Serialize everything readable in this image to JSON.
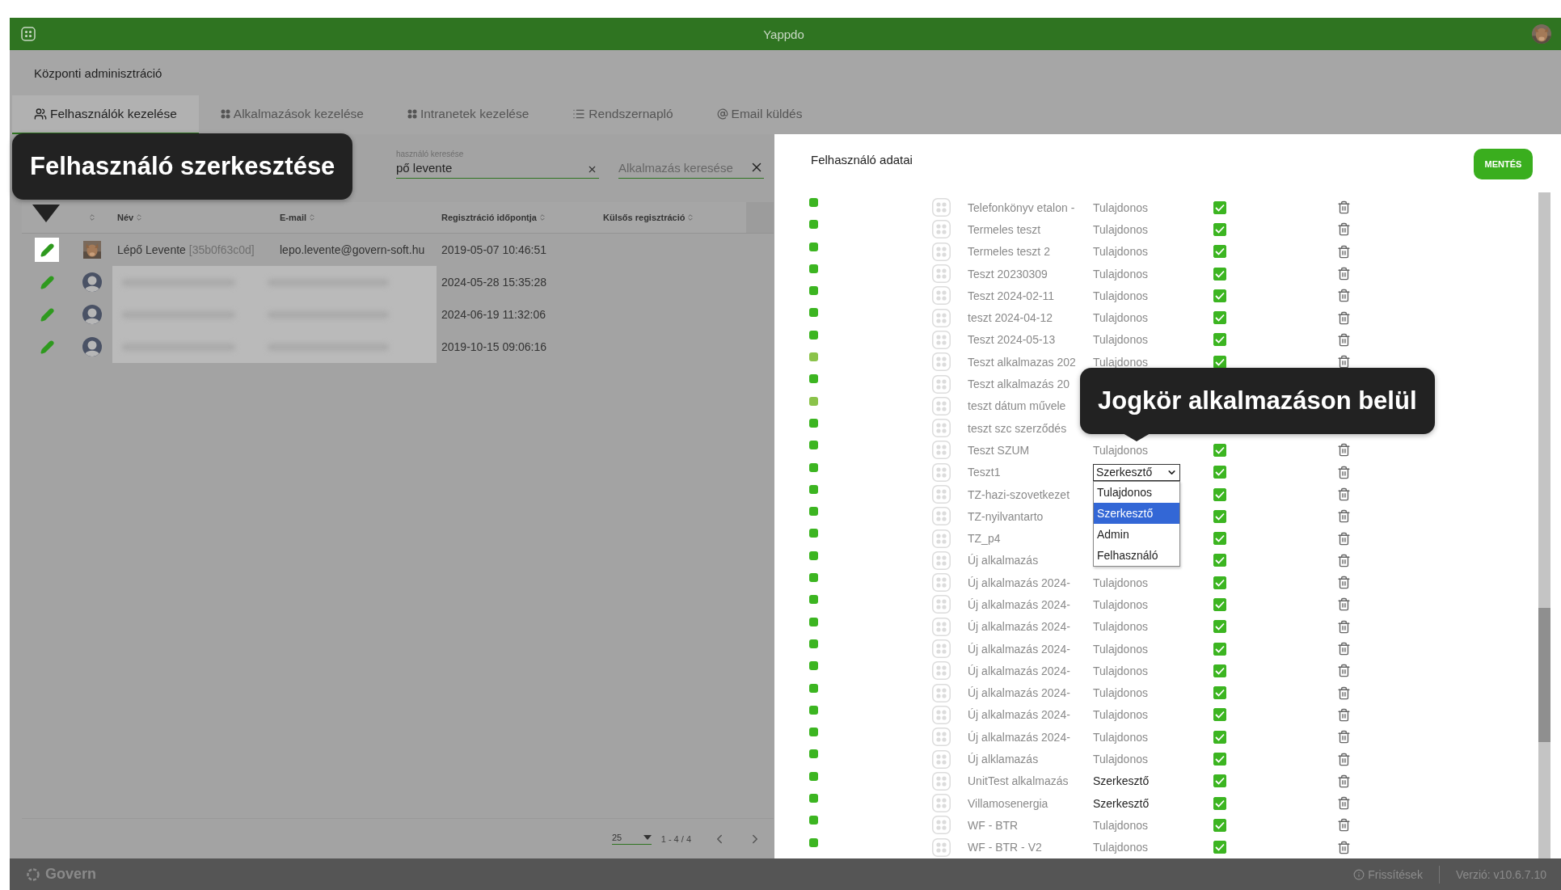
{
  "app_bar": {
    "title": "Yappdo"
  },
  "page_title": "Központi adminisztráció",
  "tabs": [
    {
      "label": "Felhasználók kezelése",
      "selected": true
    },
    {
      "label": "Alkalmazások kezelése",
      "selected": false
    },
    {
      "label": "Intranetek kezelése",
      "selected": false
    },
    {
      "label": "Rendszernapló",
      "selected": false
    },
    {
      "label": "Email küldés",
      "selected": false
    }
  ],
  "user_search": {
    "label": "használó keresése",
    "value": "pő levente"
  },
  "app_search": {
    "placeholder": "Alkalmazás keresése"
  },
  "table": {
    "columns": [
      {
        "sortable": true
      },
      {
        "label": "Név",
        "sortable": true
      },
      {
        "label": "E-mail",
        "sortable": true
      },
      {
        "label": "Regisztráció időpontja",
        "sortable": true
      },
      {
        "label": "Külsős regisztráció",
        "sortable": true
      }
    ],
    "rows": [
      {
        "selected": true,
        "blurred": false,
        "name": "Lépő Levente",
        "user_id": "[35b0f63c0d]",
        "email": "lepo.levente@govern-soft.hu",
        "registered": "2019-05-07 10:46:51"
      },
      {
        "selected": false,
        "avatar": {
          "kind": "silhouette"
        },
        "blurred": true,
        "registered": "2024-05-28 15:35:28"
      },
      {
        "selected": false,
        "avatar": {
          "kind": "silhouette"
        },
        "blurred": true,
        "registered": "2024-06-19 11:32:06"
      },
      {
        "selected": false,
        "avatar": {
          "kind": "silhouette"
        },
        "blurred": true,
        "registered": "2019-10-15 09:06:16"
      }
    ]
  },
  "pagination": {
    "page_size": "25",
    "range": "1 - 4 / 4"
  },
  "drawer": {
    "title": "Felhasználó adatai",
    "save_label": "MENTÉS",
    "apps": [
      {
        "name": "Telefonkönyv etalon -",
        "role": "Tulajdonos",
        "role_modified": false,
        "color": "#3cb521",
        "checked": true,
        "deletable": true
      },
      {
        "name": "Termeles teszt",
        "role": "Tulajdonos",
        "role_modified": false,
        "color": "#3cb521",
        "checked": true,
        "deletable": true
      },
      {
        "name": "Termeles teszt 2",
        "role": "Tulajdonos",
        "role_modified": false,
        "color": "#3cb521",
        "checked": true,
        "deletable": true
      },
      {
        "name": "Teszt 20230309",
        "role": "Tulajdonos",
        "role_modified": false,
        "color": "#3cb521",
        "checked": true,
        "deletable": true
      },
      {
        "name": "Teszt 2024-02-11",
        "role": "Tulajdonos",
        "role_modified": false,
        "color": "#3cb521",
        "checked": true,
        "deletable": true
      },
      {
        "name": "teszt 2024-04-12",
        "role": "Tulajdonos",
        "role_modified": false,
        "color": "#3cb521",
        "checked": true,
        "deletable": true
      },
      {
        "name": "Teszt 2024-05-13",
        "role": "Tulajdonos",
        "role_modified": false,
        "color": "#3cb521",
        "checked": true,
        "deletable": true
      },
      {
        "name": "Teszt alkalmazas 202",
        "role": "Tulajdonos",
        "role_modified": false,
        "color": "#8bc34a",
        "checked": true,
        "deletable": true
      },
      {
        "name": "Teszt alkalmazás 20",
        "color": "#3cb521",
        "deletable": false
      },
      {
        "name": "teszt dátum művele",
        "color": "#8bc34a",
        "deletable": false
      },
      {
        "name": "teszt szc szerződés",
        "color": "#3cb521",
        "deletable": false
      },
      {
        "name": "Teszt SZUM",
        "role": "Tulajdonos",
        "role_modified": false,
        "color": "#3cb521",
        "checked": true,
        "deletable": true
      },
      {
        "name": "Teszt1",
        "role_select": {
          "value": "Szerkesztő",
          "open": true,
          "options": [
            {
              "label": "Tulajdonos",
              "selected": false
            },
            {
              "label": "Szerkesztő",
              "selected": true
            },
            {
              "label": "Admin",
              "selected": false
            },
            {
              "label": "Felhasználó",
              "selected": false
            }
          ]
        },
        "color": "#3cb521",
        "checked": true,
        "deletable": true
      },
      {
        "name": "TZ-hazi-szovetkezet",
        "color": "#3cb521",
        "checked": true,
        "deletable": true
      },
      {
        "name": "TZ-nyilvantarto",
        "color": "#3cb521",
        "checked": true,
        "deletable": true
      },
      {
        "name": "TZ_p4",
        "color": "#3cb521",
        "checked": true,
        "deletable": true
      },
      {
        "name": "Új alkalmazás",
        "color": "#3cb521",
        "checked": true,
        "deletable": true
      },
      {
        "name": "Új alkalmazás 2024-",
        "role": "Tulajdonos",
        "role_modified": false,
        "color": "#3cb521",
        "checked": true,
        "deletable": true
      },
      {
        "name": "Új alkalmazás 2024-",
        "role": "Tulajdonos",
        "role_modified": false,
        "color": "#3cb521",
        "checked": true,
        "deletable": true
      },
      {
        "name": "Új alkalmazás 2024-",
        "role": "Tulajdonos",
        "role_modified": false,
        "color": "#3cb521",
        "checked": true,
        "deletable": true
      },
      {
        "name": "Új alkalmazás 2024-",
        "role": "Tulajdonos",
        "role_modified": false,
        "color": "#3cb521",
        "checked": true,
        "deletable": true
      },
      {
        "name": "Új alkalmazás 2024-",
        "role": "Tulajdonos",
        "role_modified": false,
        "color": "#3cb521",
        "checked": true,
        "deletable": true
      },
      {
        "name": "Új alkalmazás 2024-",
        "role": "Tulajdonos",
        "role_modified": false,
        "color": "#3cb521",
        "checked": true,
        "deletable": true
      },
      {
        "name": "Új alkalmazás 2024-",
        "role": "Tulajdonos",
        "role_modified": false,
        "color": "#3cb521",
        "checked": true,
        "deletable": true
      },
      {
        "name": "Új alkalmazás 2024-",
        "role": "Tulajdonos",
        "role_modified": false,
        "color": "#3cb521",
        "checked": true,
        "deletable": true
      },
      {
        "name": "Új alklamazás",
        "role": "Tulajdonos",
        "role_modified": false,
        "color": "#3cb521",
        "checked": true,
        "deletable": true
      },
      {
        "name": "UnitTest alkalmazás",
        "role": "Szerkesztő",
        "role_modified": true,
        "color": "#3cb521",
        "checked": true,
        "deletable": true
      },
      {
        "name": "Villamosenergia",
        "role": "Szerkesztő",
        "role_modified": true,
        "color": "#3cb521",
        "checked": true,
        "deletable": true
      },
      {
        "name": "WF - BTR",
        "role": "Tulajdonos",
        "role_modified": false,
        "color": "#3cb521",
        "checked": true,
        "deletable": true
      },
      {
        "name": "WF - BTR - V2",
        "role": "Tulajdonos",
        "role_modified": false,
        "color": "#3cb521",
        "checked": true,
        "deletable": true
      }
    ]
  },
  "tooltips": [
    {
      "text": "Felhasználó szerkesztése"
    },
    {
      "text": "Jogkör alkalmazáson belül"
    }
  ],
  "footer": {
    "brand": "Govern",
    "updates": "Frissítések",
    "version": "Verzió: v10.6.7.10"
  }
}
